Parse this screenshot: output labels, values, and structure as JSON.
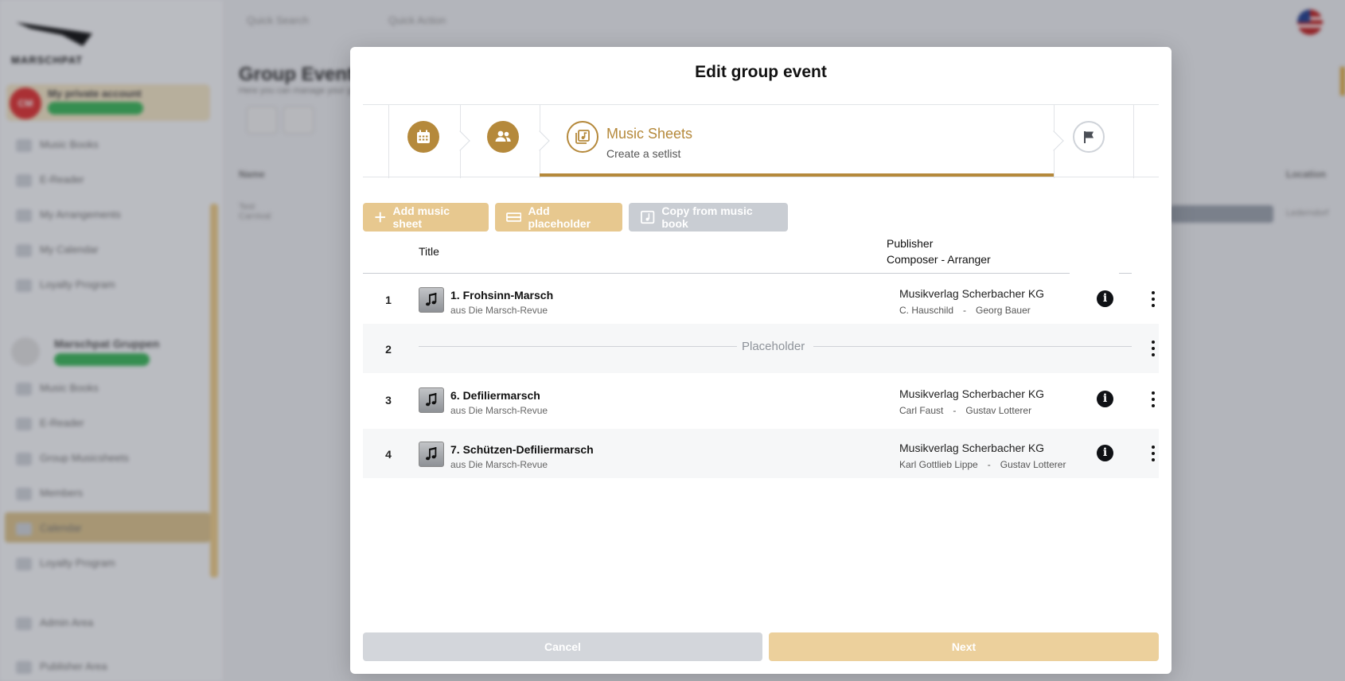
{
  "background": {
    "logo_text": "MARSCHPAT",
    "account_name": "My private account",
    "account_initials": "CM",
    "nav_top": [
      "Music Books",
      "E-Reader",
      "My Arrangements",
      "My Calendar",
      "Loyalty Program"
    ],
    "group_name": "Marschpat Gruppen",
    "nav_group": [
      "Music Books",
      "E-Reader",
      "Group Musicsheets",
      "Members",
      "Calendar",
      "Loyalty Program"
    ],
    "nav_bottom": [
      "Admin Area",
      "Publisher Area"
    ],
    "search_placeholder": "Quick Search",
    "quick_action": "Quick Action",
    "page_title": "Group Events",
    "page_subtitle": "Here you can manage your group events",
    "col_name": "Name",
    "col_location": "Location",
    "row_label": "Test",
    "row_name": "Carnival",
    "row_location": "Lederndorf"
  },
  "modal": {
    "title": "Edit group event",
    "active_step": {
      "label": "Music Sheets",
      "subtitle": "Create a setlist"
    },
    "steps": [
      {
        "icon": "calendar-icon",
        "state": "done"
      },
      {
        "icon": "group-icon",
        "state": "done"
      },
      {
        "icon": "music-sheet-icon",
        "state": "active"
      },
      {
        "icon": "flag-icon",
        "state": "pending"
      }
    ],
    "toolbar": {
      "add_music_sheet": "Add music sheet",
      "add_placeholder": "Add placeholder",
      "copy_from_book": "Copy from music book"
    },
    "table": {
      "col_title": "Title",
      "col_publisher": "Publisher",
      "col_composer": "Composer - Arranger",
      "rows": [
        {
          "num": "1",
          "title": "1. Frohsinn-Marsch",
          "source": "aus Die Marsch-Revue",
          "publisher": "Musikverlag Scherbacher KG",
          "composer": "C. Hauschild",
          "arranger": "Georg Bauer"
        },
        {
          "num": "2",
          "placeholder": "Placeholder"
        },
        {
          "num": "3",
          "title": "6. Defiliermarsch",
          "source": "aus Die Marsch-Revue",
          "publisher": "Musikverlag Scherbacher KG",
          "composer": "Carl Faust",
          "arranger": "Gustav Lotterer"
        },
        {
          "num": "4",
          "title": "7. Schützen-Defiliermarsch",
          "source": "aus Die Marsch-Revue",
          "publisher": "Musikverlag Scherbacher KG",
          "composer": "Karl Gottlieb Lippe",
          "arranger": "Gustav Lotterer"
        }
      ],
      "separator": "-"
    },
    "footer": {
      "cancel": "Cancel",
      "next": "Next"
    }
  },
  "colors": {
    "accent": "#b5893b",
    "accent_light": "#e7c88f",
    "disabled": "#c9cdd3"
  }
}
